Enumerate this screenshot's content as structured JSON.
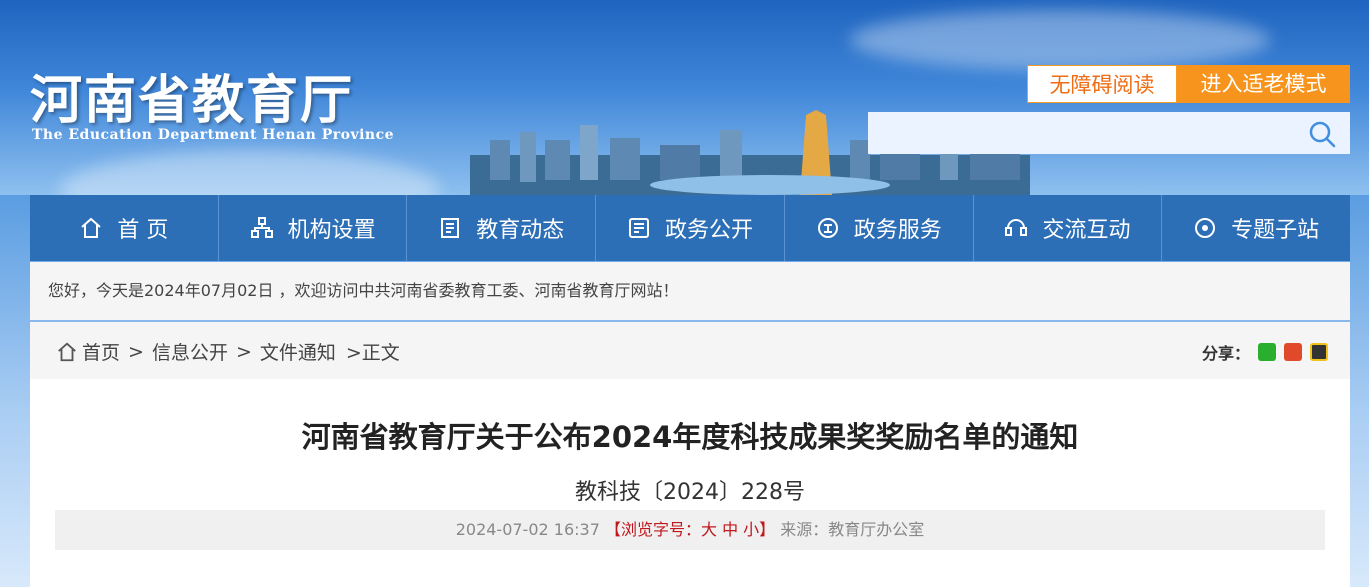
{
  "header": {
    "logo_cn": "河南省教育厅",
    "logo_en": "The Education Department Henan Province",
    "accessibility_label": "无障碍阅读",
    "elder_mode_label": "进入适老模式",
    "search_placeholder": ""
  },
  "nav": {
    "items": [
      {
        "label": "首 页",
        "icon": "home-icon"
      },
      {
        "label": "机构设置",
        "icon": "org-icon"
      },
      {
        "label": "教育动态",
        "icon": "news-icon"
      },
      {
        "label": "政务公开",
        "icon": "gov-open-icon"
      },
      {
        "label": "政务服务",
        "icon": "gov-service-icon"
      },
      {
        "label": "交流互动",
        "icon": "interact-icon"
      },
      {
        "label": "专题子站",
        "icon": "topic-icon"
      }
    ]
  },
  "welcome": "您好，今天是2024年07月02日 ，欢迎访问中共河南省委教育工委、河南省教育厅网站！",
  "breadcrumb": {
    "items": [
      "首页",
      "信息公开",
      "文件通知"
    ],
    "current": ">正文"
  },
  "share": {
    "label": "分享："
  },
  "article": {
    "title": "河南省教育厅关于公布2024年度科技成果奖奖励名单的通知",
    "doc_no": "教科技〔2024〕228号",
    "datetime": "2024-07-02 16:37",
    "font_size_label": "【浏览字号：大 中 小】",
    "source": "来源：教育厅办公室"
  },
  "colors": {
    "nav_bg": "#2c6fb7",
    "orange": "#f7941d",
    "red": "#c0161c"
  }
}
